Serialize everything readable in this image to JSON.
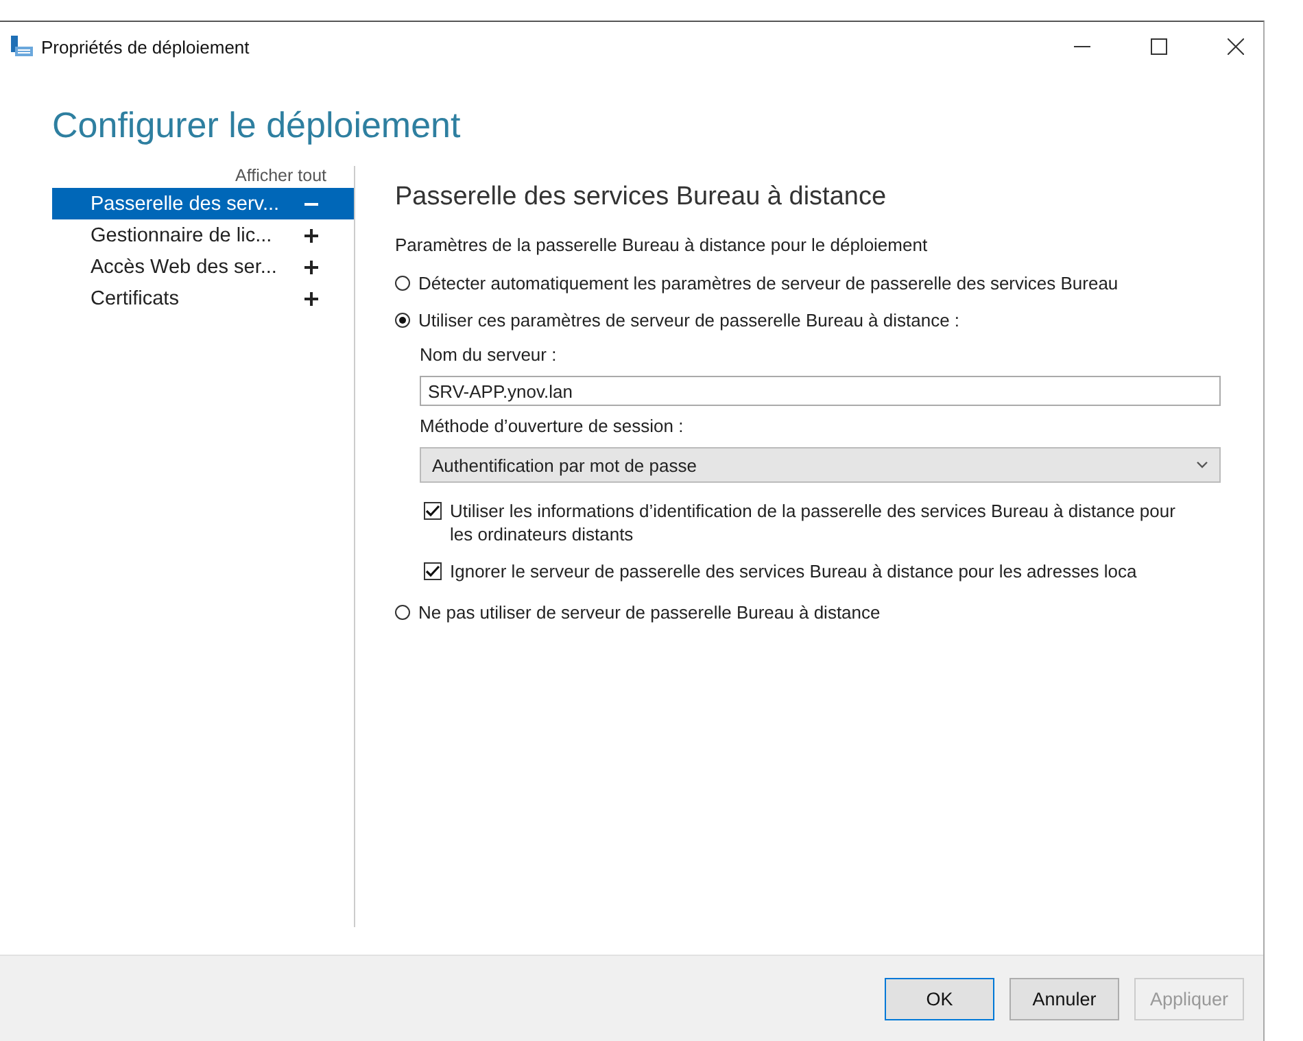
{
  "window": {
    "title": "Propriétés de déploiement"
  },
  "heading": "Configurer le déploiement",
  "sidebar": {
    "show_all": "Afficher tout",
    "items": [
      {
        "label": "Passerelle des serv...",
        "selected": true,
        "expanded": true
      },
      {
        "label": "Gestionnaire de lic...",
        "selected": false,
        "expanded": false
      },
      {
        "label": "Accès Web des ser...",
        "selected": false,
        "expanded": false
      },
      {
        "label": "Certificats",
        "selected": false,
        "expanded": false
      }
    ]
  },
  "panel": {
    "title": "Passerelle des services Bureau à distance",
    "intro": "Paramètres de la passerelle Bureau à distance pour le déploiement",
    "options": [
      {
        "label": "Détecter automatiquement les paramètres de serveur de passerelle des services Bureau",
        "selected": false
      },
      {
        "label": "Utiliser ces paramètres de serveur de passerelle Bureau à distance :",
        "selected": true,
        "settings": {
          "server_label": "Nom du serveur :",
          "server_value": "SRV-APP.ynov.lan",
          "method_label": "Méthode d’ouverture de session :",
          "method_value": "Authentification par mot de passe",
          "checkboxes": [
            {
              "label": "Utiliser les informations d’identification de la passerelle des services Bureau à distance pour les ordinateurs distants",
              "checked": true
            },
            {
              "label": "Ignorer le serveur de passerelle des services Bureau à distance pour les adresses loca",
              "checked": true
            }
          ]
        }
      },
      {
        "label": "Ne pas utiliser de serveur de passerelle Bureau à distance",
        "selected": false
      }
    ]
  },
  "buttons": [
    {
      "label": "OK",
      "default": true,
      "disabled": false
    },
    {
      "label": "Annuler",
      "default": false,
      "disabled": false
    },
    {
      "label": "Appliquer",
      "default": false,
      "disabled": true
    }
  ]
}
